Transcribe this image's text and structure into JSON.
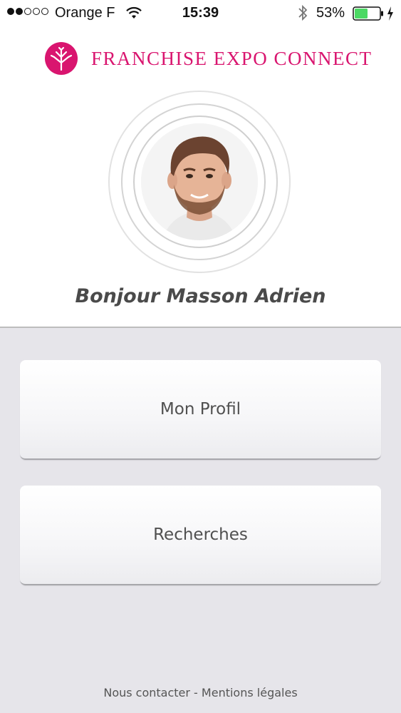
{
  "status_bar": {
    "signal_dots_filled": 2,
    "signal_dots_total": 5,
    "carrier": "Orange F",
    "time": "15:39",
    "battery_percent": "53%",
    "battery_level": 0.53,
    "icons": [
      "wifi-icon",
      "bluetooth-icon",
      "battery-icon",
      "charging-icon"
    ]
  },
  "header": {
    "brand": "FRANCHISE EXPO CONNECT",
    "brand_color": "#d9156f",
    "logo_icon": "tree-logo-icon"
  },
  "profile": {
    "avatar_icon": "user-photo",
    "greeting": "Bonjour Masson Adrien"
  },
  "menu": {
    "profil_label": "Mon Profil",
    "recherches_label": "Recherches"
  },
  "footer": {
    "contact_label": "Nous contacter",
    "separator": " - ",
    "legal_label": "Mentions légales"
  }
}
